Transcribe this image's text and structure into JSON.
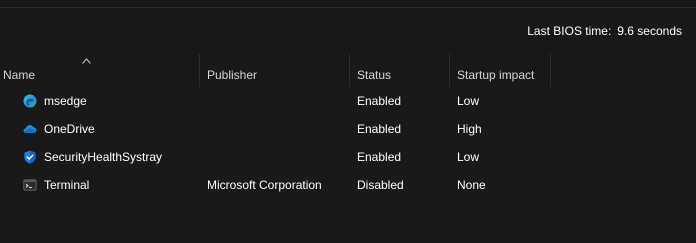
{
  "bios": {
    "label": "Last BIOS time:",
    "value": "9.6 seconds"
  },
  "columns": [
    {
      "key": "name",
      "label": "Name",
      "sorted": "ascending"
    },
    {
      "key": "publisher",
      "label": "Publisher"
    },
    {
      "key": "status",
      "label": "Status"
    },
    {
      "key": "impact",
      "label": "Startup impact"
    }
  ],
  "rows": [
    {
      "icon": "edge-icon",
      "name": "msedge",
      "publisher": "",
      "status": "Enabled",
      "impact": "Low"
    },
    {
      "icon": "onedrive-icon",
      "name": "OneDrive",
      "publisher": "",
      "status": "Enabled",
      "impact": "High"
    },
    {
      "icon": "security-shield-icon",
      "name": "SecurityHealthSystray",
      "publisher": "",
      "status": "Enabled",
      "impact": "Low"
    },
    {
      "icon": "terminal-icon",
      "name": "Terminal",
      "publisher": "Microsoft Corporation",
      "status": "Disabled",
      "impact": "None"
    }
  ],
  "colors": {
    "background": "#191919",
    "text": "#ffffff",
    "header_text": "#d6d6d6",
    "separator": "#2e2e2e"
  }
}
